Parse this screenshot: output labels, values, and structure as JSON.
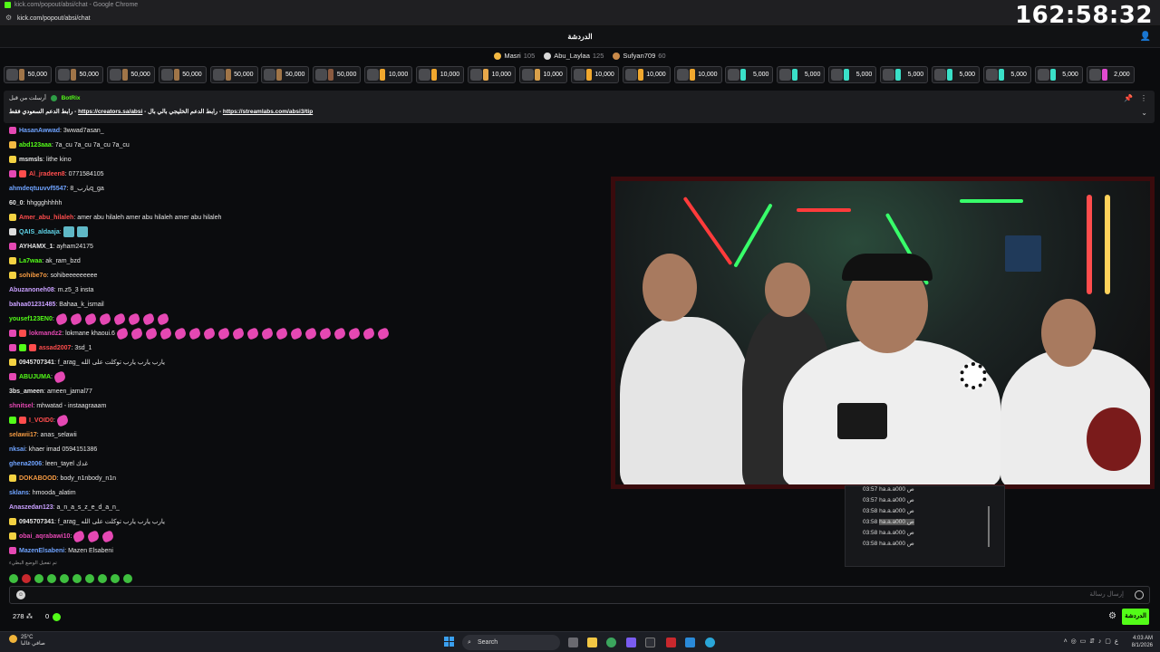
{
  "browser": {
    "tab_title": "kick.com/popout/absi/chat - Google Chrome",
    "url": "kick.com/popout/absi/chat"
  },
  "header": {
    "title": "الدردشة",
    "timer": "162:58:32"
  },
  "leaderboard": [
    {
      "name": "Masri",
      "score": "105",
      "color": "#f4b942"
    },
    {
      "name": "Abu_Laylaa",
      "score": "125",
      "color": "#d9d9d9"
    },
    {
      "name": "Sufyan709",
      "score": "60",
      "color": "#c98a4a"
    }
  ],
  "gifts": [
    {
      "amount": "50,000",
      "color": "#a07548"
    },
    {
      "amount": "50,000",
      "color": "#a07548"
    },
    {
      "amount": "50,000",
      "color": "#a07548"
    },
    {
      "amount": "50,000",
      "color": "#a07548"
    },
    {
      "amount": "50,000",
      "color": "#a07548"
    },
    {
      "amount": "50,000",
      "color": "#a07548"
    },
    {
      "amount": "50,000",
      "color": "#8a5a40"
    },
    {
      "amount": "10,000",
      "color": "#f1a82e"
    },
    {
      "amount": "10,000",
      "color": "#f1a82e"
    },
    {
      "amount": "10,000",
      "color": "#e8a84a"
    },
    {
      "amount": "10,000",
      "color": "#d9a04a"
    },
    {
      "amount": "10,000",
      "color": "#f1a82e"
    },
    {
      "amount": "10,000",
      "color": "#f1a82e"
    },
    {
      "amount": "10,000",
      "color": "#f1a82e"
    },
    {
      "amount": "5,000",
      "color": "#3ae0c8"
    },
    {
      "amount": "5,000",
      "color": "#3ae0c8"
    },
    {
      "amount": "5,000",
      "color": "#3ae0c8"
    },
    {
      "amount": "5,000",
      "color": "#3ae0c8"
    },
    {
      "amount": "5,000",
      "color": "#3ae0c8"
    },
    {
      "amount": "5,000",
      "color": "#3ae0c8"
    },
    {
      "amount": "5,000",
      "color": "#3ae0c8"
    },
    {
      "amount": "2,000",
      "color": "#e24bd0"
    }
  ],
  "pinned": {
    "by": "أرسلت من قبل",
    "bot": "BotRix",
    "text_prefix": "رابط الدعم السعودي فقط - ",
    "link1": "https://creators.sa/absi",
    "text_mid": " - رابط الدعم الخليجي بالي بال - ",
    "link2": "https://streamlabs.com/absi3/tip"
  },
  "messages": [
    {
      "user": "HasanAwwad",
      "color": "#6fa3ff",
      "text": "3wwad7asan_",
      "badges": [
        "#e548b3"
      ]
    },
    {
      "user": "abd123aaa",
      "color": "#53fc18",
      "text": "7a_cu 7a_cu 7a_cu 7a_cu",
      "badges": [
        "#f4b942"
      ]
    },
    {
      "user": "msmsls",
      "color": "#e6e6e6",
      "text": "lithe kino",
      "badges": [
        "#f4d242"
      ]
    },
    {
      "user": "Al_jradeen8",
      "color": "#ff4d4d",
      "text": "0771584105",
      "badges": [
        "#e548b3",
        "#ff4d4d"
      ]
    },
    {
      "user": "ahmdeqtuuvvf5547",
      "color": "#6fa3ff",
      "text": "يارب_8q_ga",
      "badges": []
    },
    {
      "user": "60_0",
      "color": "#e6e6e6",
      "text": "hhggghhhhh",
      "badges": []
    },
    {
      "user": "Amer_abu_hilaleh",
      "color": "#ff4d4d",
      "text": "amer abu hilaleh amer abu hilaleh amer abu hilaleh",
      "badges": [
        "#f4d242"
      ]
    },
    {
      "user": "QAIS_aldaaja",
      "color": "#5fd4e8",
      "text": "",
      "badges": [
        "#dddddd"
      ],
      "boxes": 2
    },
    {
      "user": "AYHAMX_1",
      "color": "#e6e6e6",
      "text": "ayham24175",
      "badges": [
        "#e548b3"
      ]
    },
    {
      "user": "La7waa",
      "color": "#53fc18",
      "text": "ak_ram_bzd",
      "badges": [
        "#f4d242"
      ]
    },
    {
      "user": "sohibe7o",
      "color": "#f49a42",
      "text": "sohibeeeeeeeee",
      "badges": [
        "#f4d242"
      ]
    },
    {
      "user": "Abuzanoneh08",
      "color": "#c9a0ff",
      "text": "m.z5_3 insta",
      "badges": []
    },
    {
      "user": "bahaa01231485",
      "color": "#c9a0ff",
      "text": "Bahaa_k_ismail",
      "badges": []
    },
    {
      "user": "yousef123EN0",
      "color": "#53fc18",
      "text": "",
      "badges": [],
      "emotes": 8
    },
    {
      "user": "lokmandz2",
      "color": "#e548b3",
      "text": "lokmane khaoui.6",
      "badges": [
        "#e548b3",
        "#ff4d4d"
      ],
      "emotes_after": 19
    },
    {
      "user": "assad2007",
      "color": "#ff4d4d",
      "text": "3sd_1",
      "badges": [
        "#e548b3",
        "#53fc18",
        "#ff4d4d"
      ]
    },
    {
      "user": "0945707341",
      "color": "#e6e6e6",
      "text": "f_arag_ يارب يارب يارب توكلت على الله",
      "badges": [
        "#f4d242"
      ]
    },
    {
      "user": "ABUJUMA",
      "color": "#53fc18",
      "text": "",
      "badges": [
        "#e548b3"
      ],
      "emotes": 1
    },
    {
      "user": "3bs_ameen",
      "color": "#e6e6e6",
      "text": "ameen_jamal77",
      "badges": []
    },
    {
      "user": "shnitsel",
      "color": "#e548b3",
      "text": "mhwatad - instaagraaam",
      "badges": []
    },
    {
      "user": "I_VOID0",
      "color": "#ff4d4d",
      "text": "",
      "badges": [
        "#53fc18",
        "#ff4d4d"
      ],
      "emotes": 1
    },
    {
      "user": "selawii17",
      "color": "#f49a42",
      "text": "anas_selawii",
      "badges": []
    },
    {
      "user": "nksai",
      "color": "#6fa3ff",
      "text": "khaer imad 0594151386",
      "badges": []
    },
    {
      "user": "ghena2006",
      "color": "#6fa3ff",
      "text": "leen_tayel غدك",
      "badges": []
    },
    {
      "user": "DOKABOOD",
      "color": "#f49a42",
      "text": "body_n1nbody_n1n",
      "badges": [
        "#f4d242"
      ]
    },
    {
      "user": "sklans",
      "color": "#6fa3ff",
      "text": "hmooda_alatim",
      "badges": []
    },
    {
      "user": "Anaszedan123",
      "color": "#c9a0ff",
      "text": "a_n_a_s_z_e_d_a_n_",
      "badges": []
    },
    {
      "user": "0945707341",
      "color": "#e6e6e6",
      "text": "f_arag_ يارب يارب يارب توكلت على الله",
      "badges": [
        "#f4d242"
      ]
    },
    {
      "user": "obai_aqrabawi10",
      "color": "#e548b3",
      "text": "",
      "badges": [
        "#f4d242"
      ],
      "emotes": 3
    },
    {
      "user": "MazenElsabeni",
      "color": "#6fa3ff",
      "text": "Mazen Elsabeni",
      "badges": [
        "#e548b3"
      ]
    }
  ],
  "typing_text": "تم تفعيل الوضع البطيء",
  "input": {
    "placeholder": "إرسال رسالة"
  },
  "footer": {
    "viewers": "278",
    "points": "0",
    "chat_button": "الدردشة"
  },
  "float_list": [
    {
      "time": "03:57",
      "text": "ha.a.a000 ص"
    },
    {
      "time": "03:57",
      "text": "ha.a.a000 ص"
    },
    {
      "time": "03:58",
      "text": "ha.a.a000 ص"
    },
    {
      "time": "03:58",
      "text": "ha.a.a000 ص"
    },
    {
      "time": "03:58",
      "text": "ha.a.a000 ص"
    },
    {
      "time": "03:58",
      "text": "ha.a.a000 ص"
    }
  ],
  "taskbar": {
    "temp": "25°C",
    "weather": "صافي غالبا",
    "search": "Search",
    "time": "4:03 AM",
    "date": "8/1/2026"
  }
}
